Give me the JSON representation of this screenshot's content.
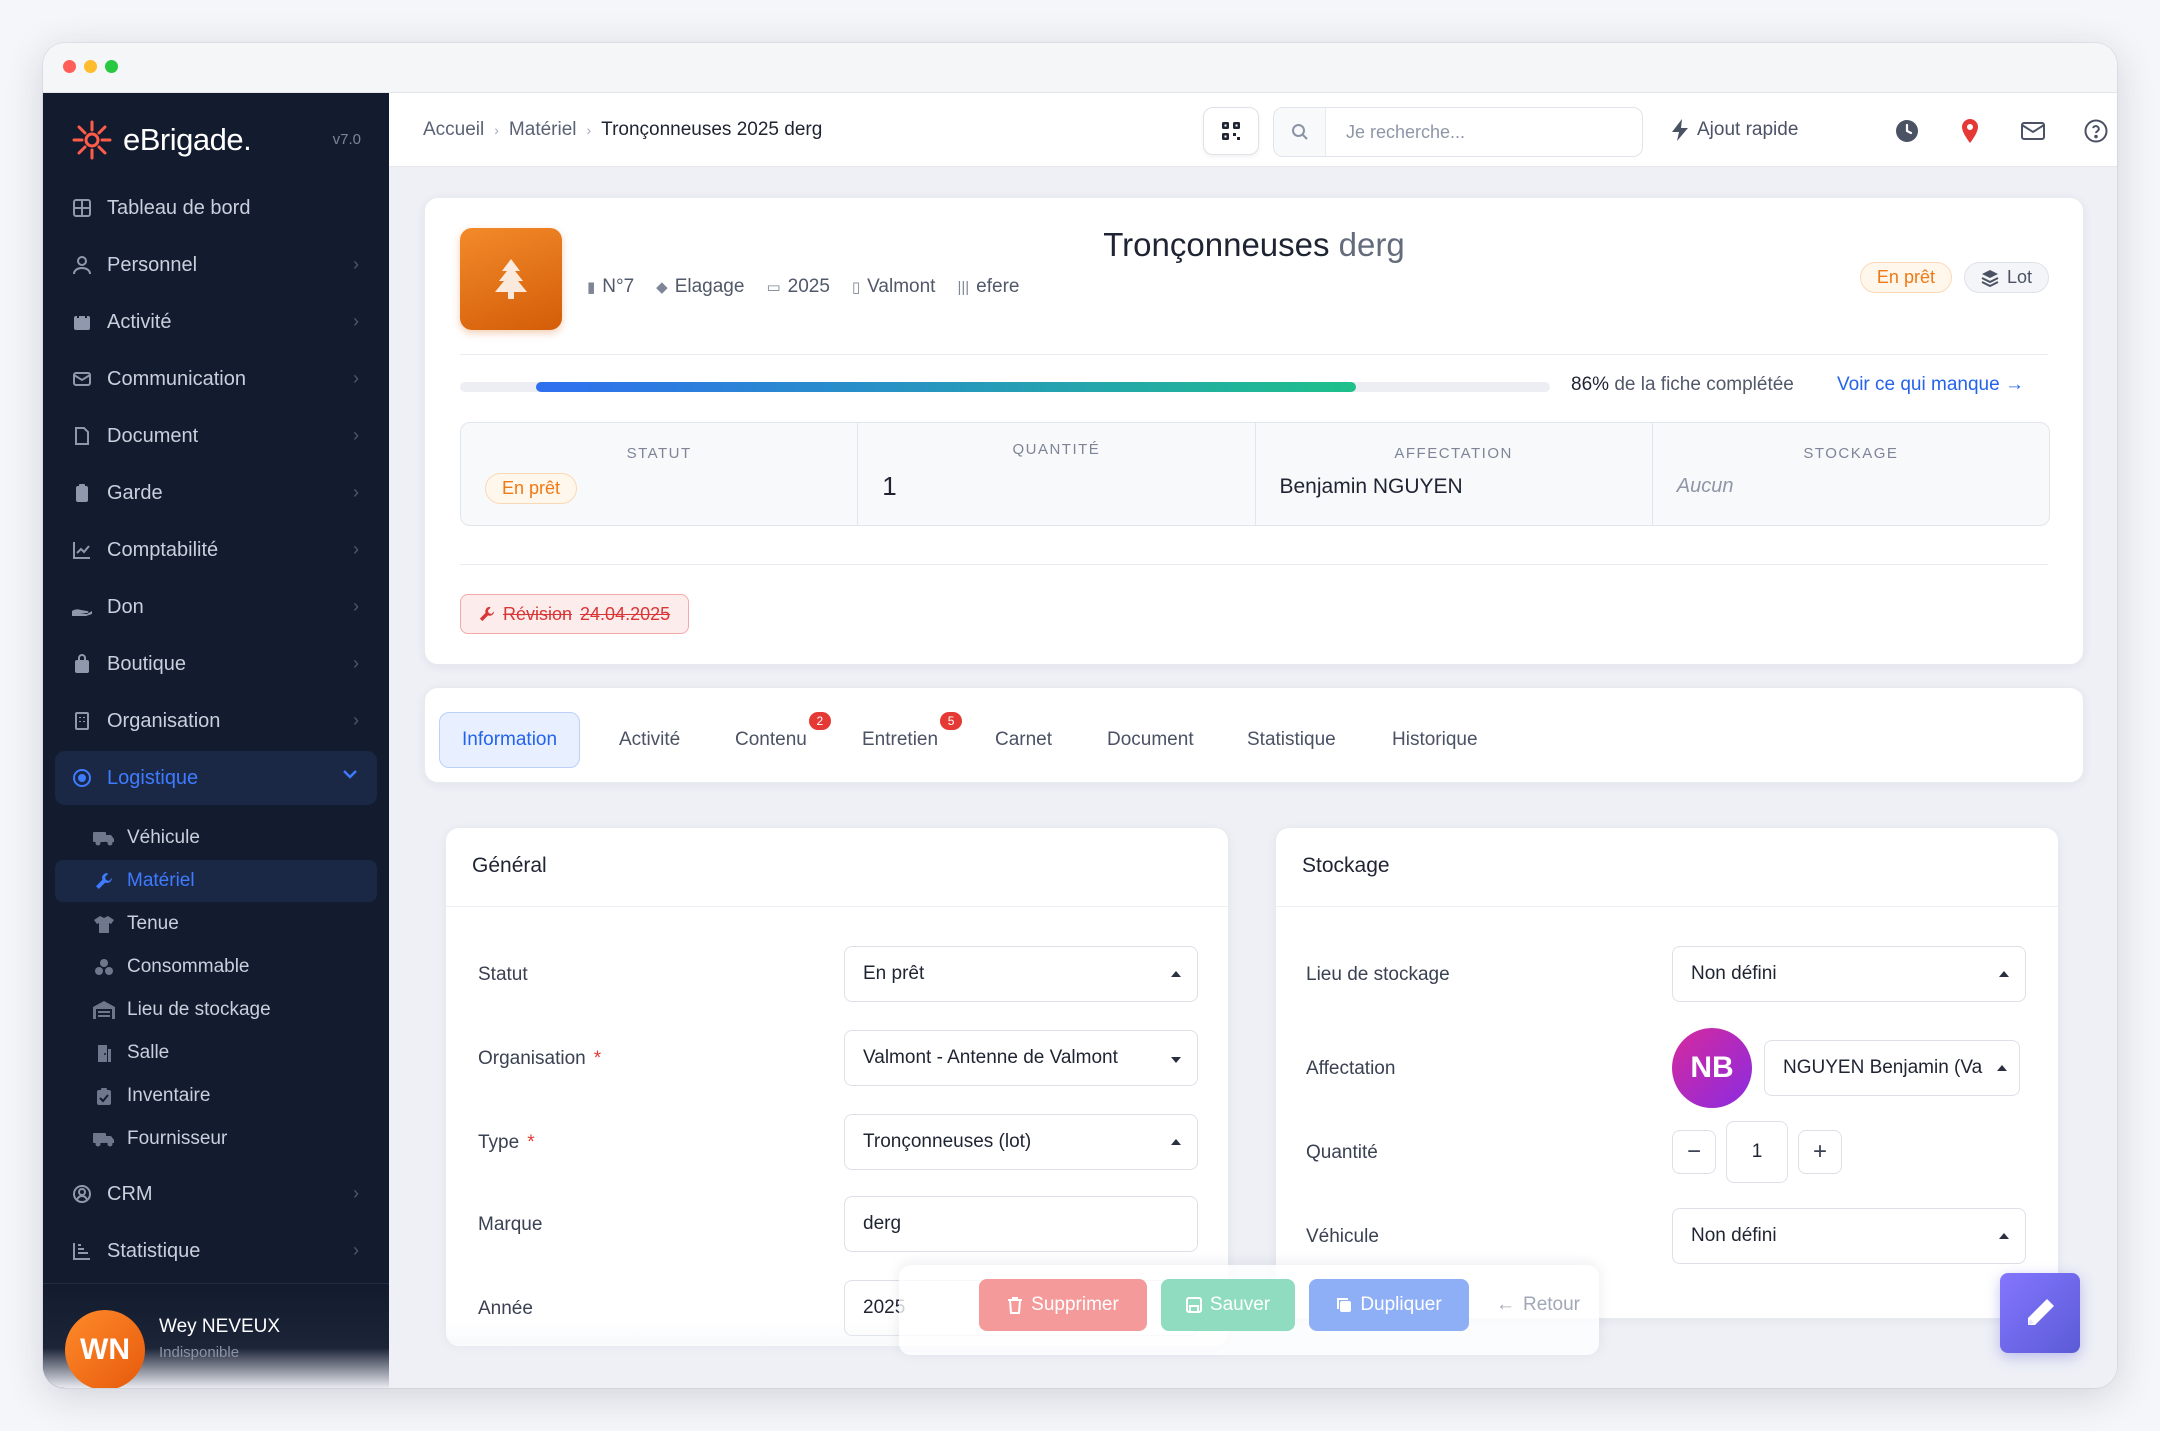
{
  "app": {
    "brand": "eBrigade.",
    "version": "v7.0"
  },
  "sidebar": {
    "items": [
      {
        "label": "Tableau de bord",
        "icon": "grid-icon"
      },
      {
        "label": "Personnel",
        "icon": "user-icon"
      },
      {
        "label": "Activité",
        "icon": "calendar-icon"
      },
      {
        "label": "Communication",
        "icon": "mail-icon"
      },
      {
        "label": "Document",
        "icon": "file-icon"
      },
      {
        "label": "Garde",
        "icon": "clipboard-icon"
      },
      {
        "label": "Comptabilité",
        "icon": "chart-icon"
      },
      {
        "label": "Don",
        "icon": "hand-icon"
      },
      {
        "label": "Boutique",
        "icon": "bag-icon"
      },
      {
        "label": "Organisation",
        "icon": "building-icon"
      },
      {
        "label": "Logistique",
        "icon": "target-icon"
      },
      {
        "label": "CRM",
        "icon": "contact-icon"
      },
      {
        "label": "Statistique",
        "icon": "stats-icon"
      }
    ],
    "subitems": [
      {
        "label": "Véhicule",
        "icon": "truck-icon"
      },
      {
        "label": "Matériel",
        "icon": "wrench-icon"
      },
      {
        "label": "Tenue",
        "icon": "shirt-icon"
      },
      {
        "label": "Consommable",
        "icon": "boxes-icon"
      },
      {
        "label": "Lieu de stockage",
        "icon": "warehouse-icon"
      },
      {
        "label": "Salle",
        "icon": "door-icon"
      },
      {
        "label": "Inventaire",
        "icon": "clipboard-check-icon"
      },
      {
        "label": "Fournisseur",
        "icon": "truck-icon"
      }
    ],
    "user": {
      "initials": "WN",
      "name": "Wey NEVEUX",
      "status": "Indisponible"
    }
  },
  "topbar": {
    "breadcrumb": [
      "Accueil",
      "Matériel",
      "Tronçonneuses 2025 derg"
    ],
    "search_placeholder": "Je recherche...",
    "quick_add": "Ajout rapide"
  },
  "item": {
    "title_main": "Tronçonneuses",
    "title_brand": "derg",
    "meta": {
      "number": "N°7",
      "category": "Elagage",
      "year": "2025",
      "location": "Valmont",
      "serial": "efere"
    },
    "badge_status": "En prêt",
    "badge_lot": "Lot",
    "completion_percent": 86,
    "completion_pct_label": "86%",
    "completion_text": "de la fiche complétée",
    "completion_link": "Voir ce qui manque →",
    "stats": {
      "statut_label": "STATUT",
      "statut_value": "En prêt",
      "quantite_label": "QUANTITÉ",
      "quantite_value": "1",
      "affectation_label": "AFFECTATION",
      "affectation_value": "Benjamin NGUYEN",
      "stockage_label": "STOCKAGE",
      "stockage_value": "Aucun"
    },
    "revision_label": "Révision",
    "revision_date": "24.04.2025"
  },
  "tabs": [
    {
      "label": "Information"
    },
    {
      "label": "Activité"
    },
    {
      "label": "Contenu",
      "count": "2"
    },
    {
      "label": "Entretien",
      "count": "5"
    },
    {
      "label": "Carnet"
    },
    {
      "label": "Document"
    },
    {
      "label": "Statistique"
    },
    {
      "label": "Historique"
    }
  ],
  "general": {
    "title": "Général",
    "statut_label": "Statut",
    "statut_value": "En prêt",
    "organisation_label": "Organisation",
    "organisation_value": "Valmont - Antenne de Valmont",
    "type_label": "Type",
    "type_value": "Tronçonneuses (lot)",
    "marque_label": "Marque",
    "marque_value": "derg",
    "annee_label": "Année",
    "annee_value": "2025",
    "required_mark": "*"
  },
  "stockage": {
    "title": "Stockage",
    "lieu_label": "Lieu de stockage",
    "lieu_value": "Non défini",
    "affectation_label": "Affectation",
    "affectation_initials": "NB",
    "affectation_value": "NGUYEN Benjamin (Va",
    "quantite_label": "Quantité",
    "quantite_value": "1",
    "vehicule_label": "Véhicule",
    "vehicule_value": "Non défini"
  },
  "actions": {
    "delete": "Supprimer",
    "save": "Sauver",
    "duplicate": "Dupliquer",
    "back": "Retour"
  },
  "colors": {
    "accent": "#2463eb",
    "sidebar_bg": "#131b2e",
    "status_orange": "#ee7a16",
    "danger": "#e53935",
    "success": "#1ec08a"
  }
}
